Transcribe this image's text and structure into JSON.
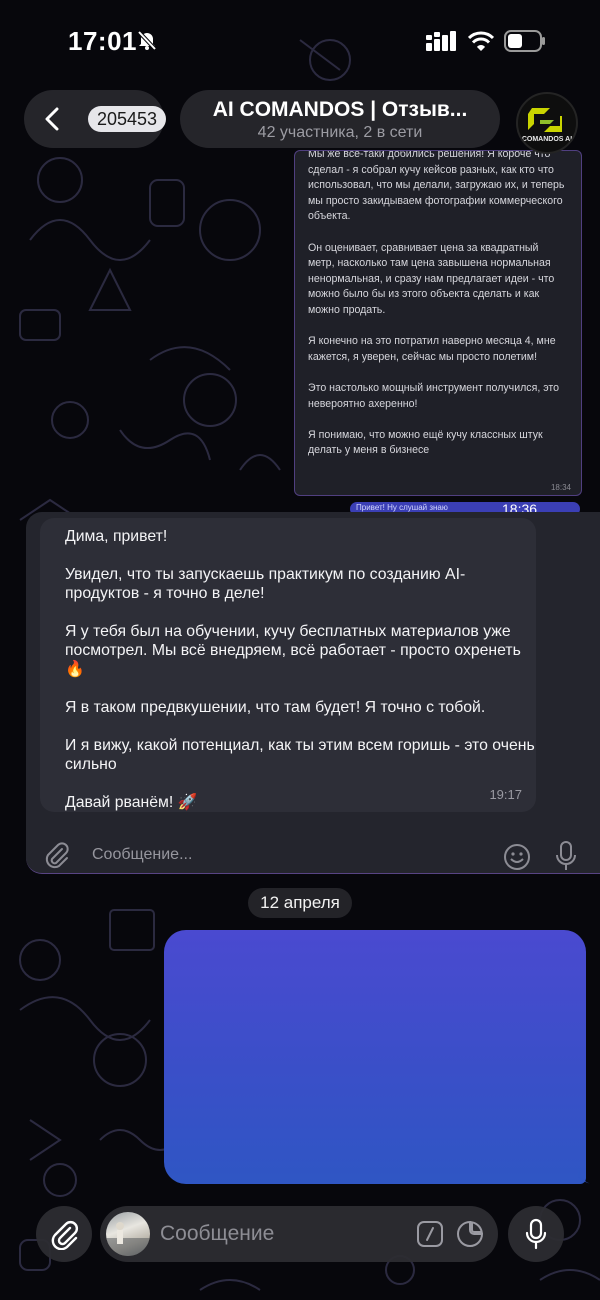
{
  "status": {
    "time": "17:01"
  },
  "header": {
    "unread_count": "205453",
    "title": "AI COMANDOS | Отзыв...",
    "subtitle": "42 участника, 2 в сети",
    "avatar_label": "COMANDOS AI"
  },
  "screenshot_message": {
    "text": "Мы же все-таки добились решения! Я короче что сделал - я собрал кучу кейсов разных, как кто что использовал, что мы делали, загружаю их, и теперь мы просто закидываем фотографии коммерческого объекта.\n\nОн оценивает, сравнивает цена за квадратный метр, насколько там цена завышена нормальная ненормальная, и сразу нам предлагает идеи - что можно было бы из этого объекта сделать и как можно продать.\n\nЯ конечно на это потратил наверно месяца 4, мне кажется, я уверен, сейчас мы просто полетим!\n\nЭто настолько мощный инструмент получился, это невероятно ахеренно!\n\nЯ понимаю, что можно ещё кучу классных штук делать у меня в бизнесе",
    "time": "18:34",
    "strip_text": "Привет! Ну слушай знаю",
    "strip_time": "18:36"
  },
  "review_message": {
    "text": "Дима, привет!\n\nУвидел, что ты запускаешь практикум по созданию AI-продуктов - я точно в деле!\n\nЯ у тебя был на обучении, кучу бесплатных материалов уже посмотрел. Мы всё внедряем, всё работает - просто охренеть 🔥\n\nЯ в таком предвкушении, что там будет! Я точно с тобой.\n\nИ я вижу, какой потенциал, как ты этим всем горишь - это очень сильно\n\nДавай рванём! 🚀",
    "time": "19:17",
    "inner_placeholder": "Сообщение..."
  },
  "date_separator": "12 апреля",
  "composer": {
    "placeholder": "Сообщение"
  },
  "colors": {
    "outgoing_top": "#4a4ad0",
    "outgoing_bottom": "#2f56c4",
    "panel": "#24252d"
  }
}
